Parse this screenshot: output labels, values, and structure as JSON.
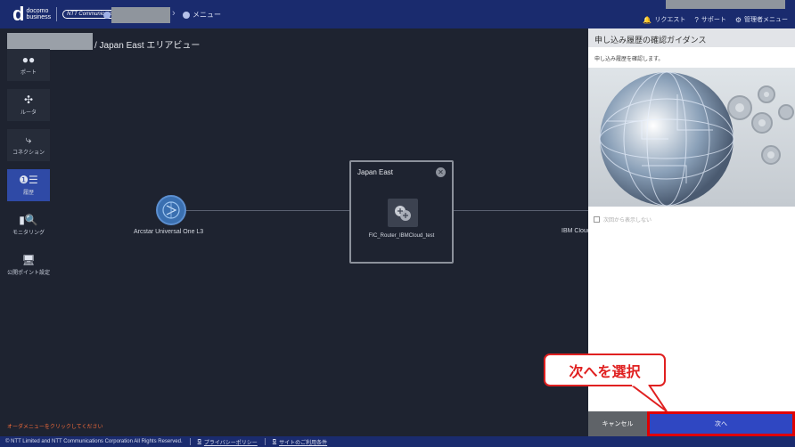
{
  "header": {
    "brand_d": "d",
    "brand_line1": "docomo",
    "brand_line2": "business",
    "ntt_logo": "NTT Communications",
    "menu_label": "メニュー",
    "right_items": [
      {
        "icon": "bell-icon",
        "glyph": "🔔",
        "label": "リクエスト"
      },
      {
        "icon": "help-icon",
        "glyph": "?",
        "label": "サポート"
      },
      {
        "icon": "gear-icon",
        "glyph": "⚙",
        "label": "管理者メニュー"
      }
    ]
  },
  "title": "/ Japan East エリアビュー",
  "nav": [
    {
      "name": "nav-port",
      "glyph": "●●",
      "label": "ポート"
    },
    {
      "name": "nav-router",
      "glyph": "✣",
      "label": "ルータ"
    },
    {
      "name": "nav-connection",
      "glyph": "⤷",
      "label": "コネクション"
    },
    {
      "name": "nav-history",
      "glyph": "❶☰",
      "label": "履歴"
    },
    {
      "name": "nav-monitoring",
      "glyph": "▮🔍",
      "label": "モニタリング"
    },
    {
      "name": "nav-public-point",
      "glyph": "🖥",
      "label": "公開ポイント設定"
    }
  ],
  "canvas": {
    "arcstar_label": "Arcstar Universal One L3",
    "area_label": "Japan East",
    "close_glyph": "✕",
    "router_label": "FIC_Router_IBMCloud_test",
    "ibm_label": "IBM Cloud"
  },
  "order_hint": "オーダメニューをクリックしてください",
  "guide": {
    "title": "申し込み履歴の確認ガイダンス",
    "description": "申し込み履歴を確認します。",
    "checkbox_label": "次回から表示しない",
    "cancel_label": "キャンセル",
    "next_label": "次へ"
  },
  "callout": "次へを選択",
  "footer": {
    "copyright": "© NTT Limited and NTT Communications Corporation All Rights Reserved.",
    "privacy": "プライバシーポリシー",
    "terms": "サイトのご利用条件"
  },
  "colors": {
    "header": "#1a2b6e",
    "background": "#1e2330",
    "accent": "#2f47c2",
    "highlight": "#e02020"
  }
}
